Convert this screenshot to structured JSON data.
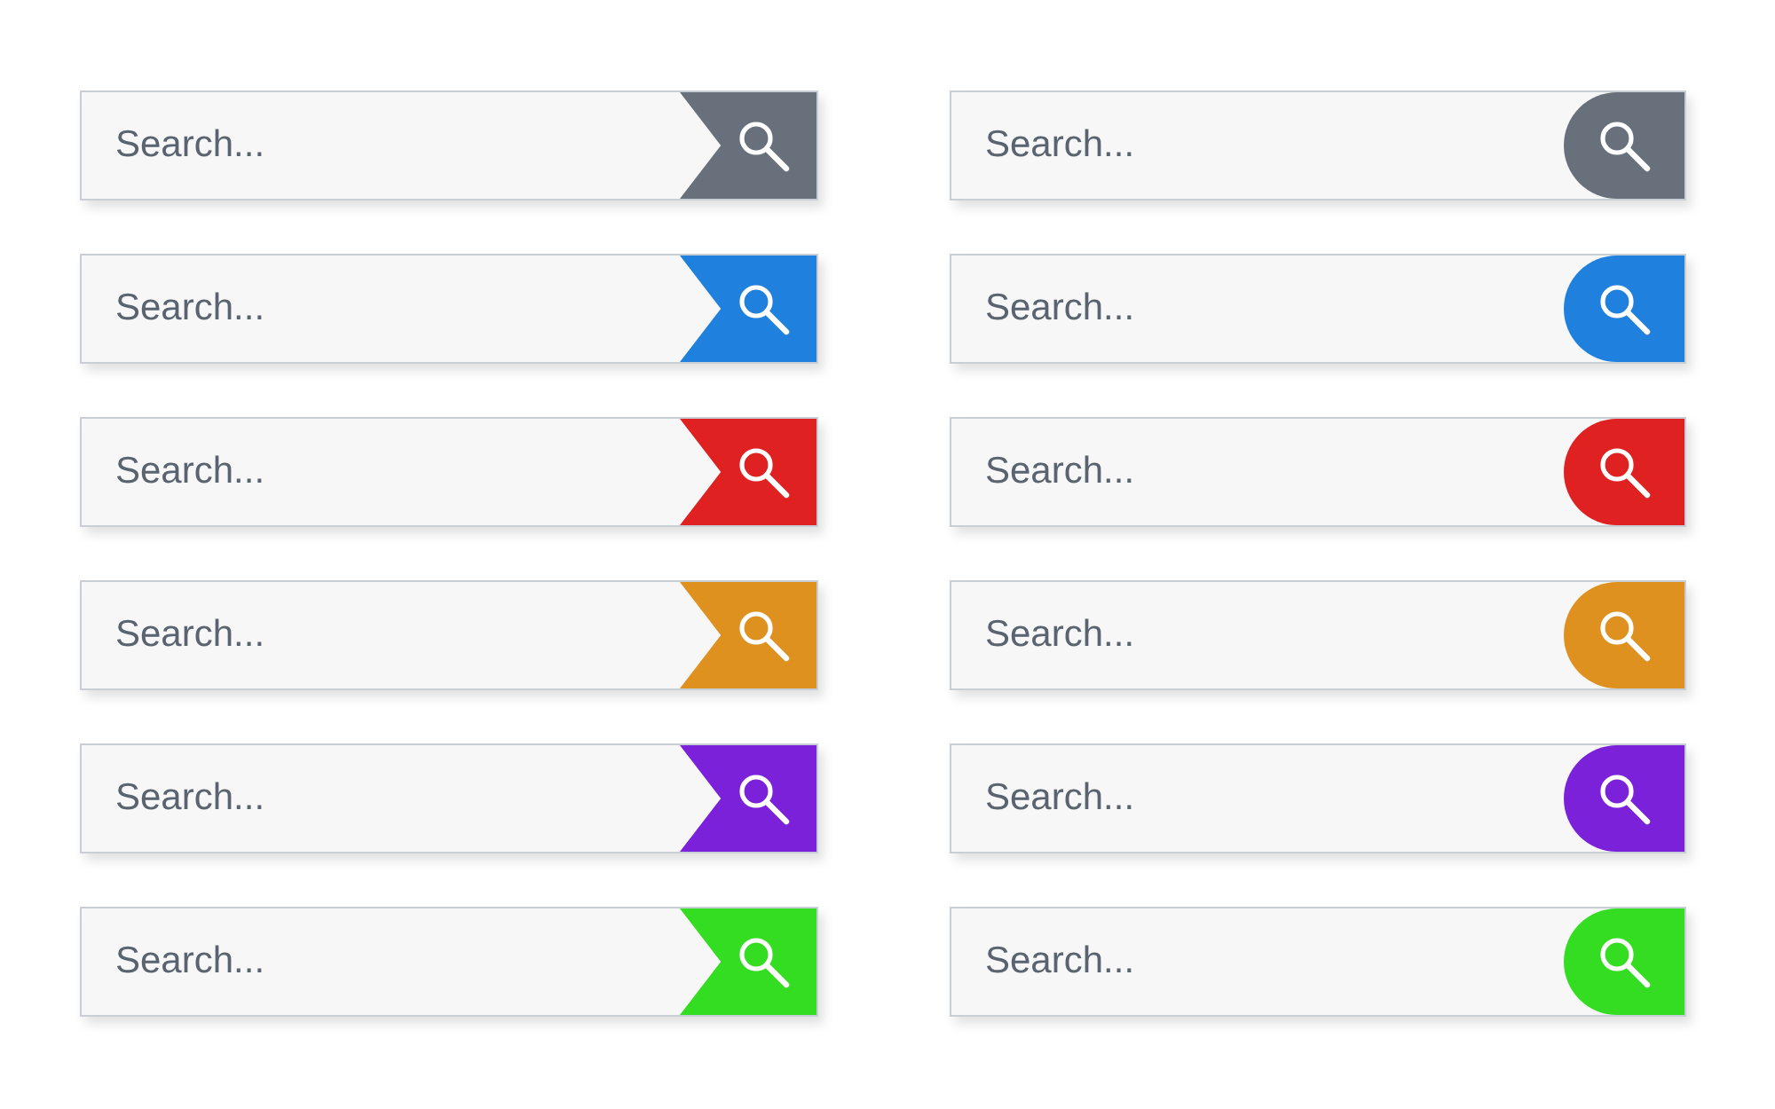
{
  "columns": [
    {
      "bars": [
        {
          "kind": "notched",
          "placeholder": "Search...",
          "color": "#68717b"
        },
        {
          "kind": "notched",
          "placeholder": "Search...",
          "color": "#1f80de"
        },
        {
          "kind": "notched",
          "placeholder": "Search...",
          "color": "#e02121"
        },
        {
          "kind": "notched",
          "placeholder": "Search...",
          "color": "#df911f"
        },
        {
          "kind": "notched",
          "placeholder": "Search...",
          "color": "#7b21d9"
        },
        {
          "kind": "notched",
          "placeholder": "Search...",
          "color": "#34dc22"
        }
      ]
    },
    {
      "bars": [
        {
          "kind": "rounded",
          "placeholder": "Search...",
          "color": "#68717b"
        },
        {
          "kind": "rounded",
          "placeholder": "Search...",
          "color": "#1f80de"
        },
        {
          "kind": "rounded",
          "placeholder": "Search...",
          "color": "#e02121"
        },
        {
          "kind": "rounded",
          "placeholder": "Search...",
          "color": "#df911f"
        },
        {
          "kind": "rounded",
          "placeholder": "Search...",
          "color": "#7b21d9"
        },
        {
          "kind": "rounded",
          "placeholder": "Search...",
          "color": "#34dc22"
        }
      ]
    }
  ]
}
